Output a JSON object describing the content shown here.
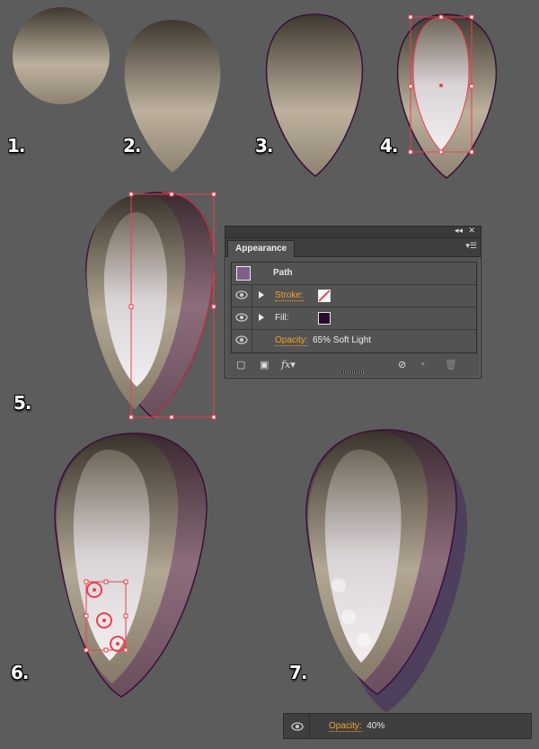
{
  "steps": [
    "1.",
    "2.",
    "3.",
    "4.",
    "5.",
    "6.",
    "7."
  ],
  "panel": {
    "tab_label": "Appearance",
    "collapse_icon": "double-chevron-left-icon",
    "close_icon": "close-icon",
    "menu_icon": "panel-menu-icon",
    "object_label": "Path",
    "object_swatch_color": "#7d5f8a",
    "stroke_label": "Stroke:",
    "fill_label": "Fill:",
    "fill_color": "#2a0a2e",
    "opacity_label": "Opacity:",
    "opacity_value": "65% Soft Light",
    "footer_icons": [
      "add-new-stroke-icon",
      "add-new-fill-icon",
      "fx-icon",
      "clear-appearance-icon",
      "duplicate-item-icon",
      "trash-icon"
    ],
    "fx_label": "fx"
  },
  "strip": {
    "opacity_label": "Opacity:",
    "opacity_value": "40%"
  },
  "colors": {
    "background": "#5c5c5c",
    "accent_link": "#f2a02a",
    "selection": "#e8414f",
    "outline": "#3a0f3a"
  }
}
